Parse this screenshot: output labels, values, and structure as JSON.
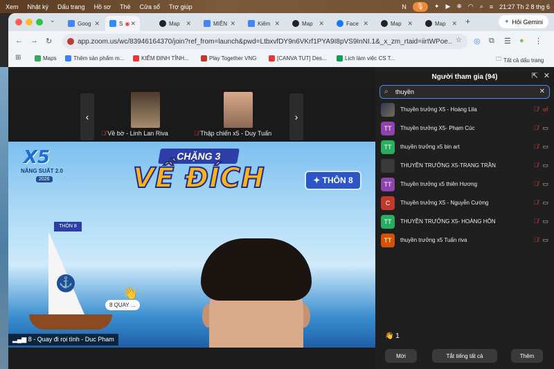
{
  "menubar": {
    "items": [
      "Xem",
      "Nhật ký",
      "Dấu trang",
      "Hồ sơ",
      "Thẻ",
      "Cửa sổ",
      "Trợ giúp"
    ],
    "clock": "21:27 Th 2 8 thg 6"
  },
  "tabs": [
    {
      "label": "Goog",
      "color": "#4285f4"
    },
    {
      "label": "S",
      "color": "#2d8cff"
    },
    {
      "label": "Map",
      "color": "#222222"
    },
    {
      "label": "MIỄN",
      "color": "#4285f4"
    },
    {
      "label": "Kiếm",
      "color": "#4285f4"
    },
    {
      "label": "Map",
      "color": "#222222"
    },
    {
      "label": "Face",
      "color": "#1877f2"
    },
    {
      "label": "Map",
      "color": "#222222"
    },
    {
      "label": "Map",
      "color": "#222222"
    }
  ],
  "gemini_label": "Hỏi Gemini",
  "url": "app.zoom.us/wc/83946164370/join?ref_from=launch&pwd=LtbxvfDY9n6VKrf1PYA9I8pVS9InNI.1&_x_zm_rtaid=iirtWPoe...",
  "bookmarks": [
    {
      "label": "Maps",
      "color": "#34a853"
    },
    {
      "label": "Thêm sản phẩm m...",
      "color": "#3b82f6"
    },
    {
      "label": "KIỂM ĐỊNH TỈNH...",
      "color": "#e53935"
    },
    {
      "label": "Play Together VNG",
      "color": "#c0392b"
    },
    {
      "label": "[CANVA TUT] Des...",
      "color": "#e53935"
    },
    {
      "label": "Lịch làm việc CS T...",
      "color": "#0f9d58"
    }
  ],
  "all_bookmarks": "Tất cả dấu trang",
  "strip": {
    "left_name": "Về bờ - Linh Lan Riva",
    "right_name": "Thập chiến x5 - Duy Tuấn"
  },
  "stage": {
    "x5": "X5",
    "nang_suat": "NĂNG SUẤT 2.0",
    "year": "2026",
    "chang": "CHẶNG 3",
    "ve_dich": "VỀ ĐÍCH",
    "thon": "✦ THÔN 8",
    "flag": "THÔN 8",
    "reaction_label": "8 QUAY ...",
    "speaker": "8 - Quay đi rọi tình - Duc Pham"
  },
  "panel": {
    "title": "Người tham gia (94)",
    "search_value": "thuyền",
    "participants": [
      {
        "name": "Thuyền trưởng X5 - Hoàng Lila",
        "initials": "",
        "color": "#3a3a3a",
        "cam_red": true
      },
      {
        "name": "Thuyền trưởng X5- Phạm Cúc",
        "initials": "TT",
        "color": "#8e44ad",
        "cam_red": false
      },
      {
        "name": "thuyền trưởng x5 bin art",
        "initials": "TT",
        "color": "#27ae60",
        "cam_red": false
      },
      {
        "name": "THUYỀN TRƯỞNG X5-TRANG TRẦN",
        "initials": "",
        "color": "#3a3a3a",
        "cam_red": false
      },
      {
        "name": "Thuyền trưởng x5 thiên Hương",
        "initials": "TT",
        "color": "#8e44ad",
        "cam_red": false
      },
      {
        "name": "Thuyền trưởng X5 - Nguyễn Cường",
        "initials": "C",
        "color": "#c0392b",
        "cam_red": false
      },
      {
        "name": "THUYỀN TRƯỞNG X5- HOÀNG HÔN",
        "initials": "TT",
        "color": "#27ae60",
        "cam_red": false
      },
      {
        "name": "thuyền trưởng x5 Tuấn riva",
        "initials": "TT",
        "color": "#d35400",
        "cam_red": false
      }
    ],
    "reaction_count": "1",
    "buttons": {
      "invite": "Mời",
      "mute_all": "Tắt tiếng tất cả",
      "more": "Thêm"
    }
  }
}
